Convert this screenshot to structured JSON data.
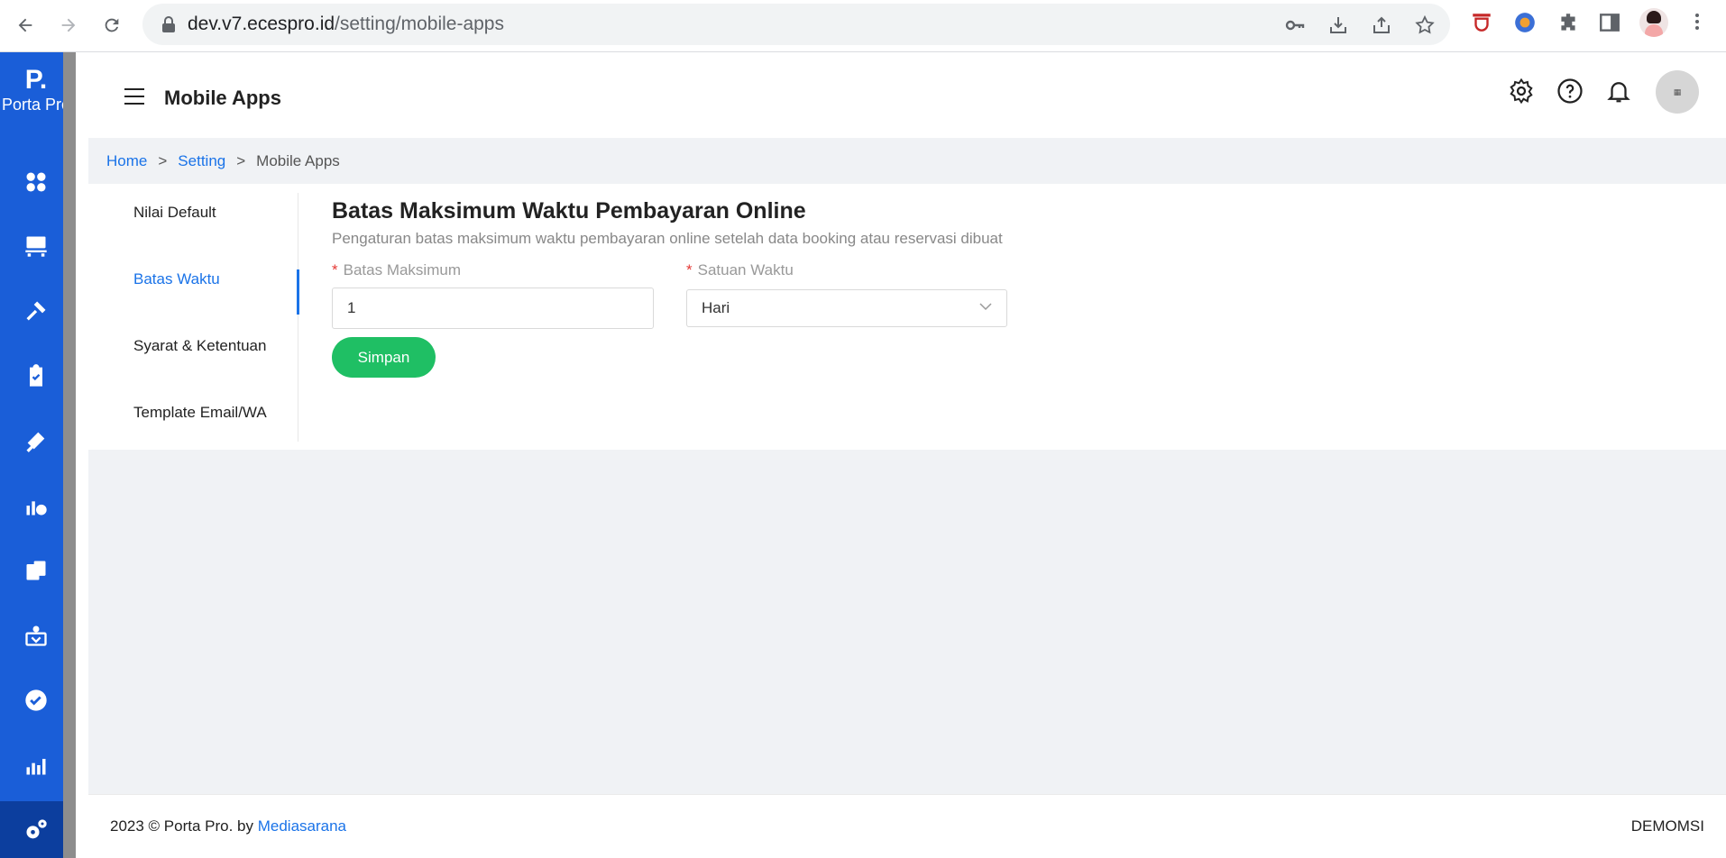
{
  "browser": {
    "url_host": "dev.v7.ecespro.id",
    "url_path": "/setting/mobile-apps"
  },
  "sidebar": {
    "logo_mark": "P.",
    "logo_text": "Porta Pro",
    "items": [
      {
        "icon": "dashboard-icon"
      },
      {
        "icon": "front-desk-icon"
      },
      {
        "icon": "tools-icon"
      },
      {
        "icon": "clipboard-icon"
      },
      {
        "icon": "marketing-icon"
      },
      {
        "icon": "finance-icon"
      },
      {
        "icon": "billing-icon"
      },
      {
        "icon": "network-icon"
      },
      {
        "icon": "verified-icon"
      },
      {
        "icon": "report-icon"
      },
      {
        "icon": "settings-icon"
      }
    ]
  },
  "header": {
    "title": "Mobile Apps",
    "avatar_text": "▦"
  },
  "breadcrumb": {
    "home": "Home",
    "sep": ">",
    "setting": "Setting",
    "current": "Mobile Apps"
  },
  "menu": {
    "items": [
      "Nilai Default",
      "Batas Waktu",
      "Syarat & Ketentuan",
      "Template Email/WA"
    ],
    "active": "Batas Waktu"
  },
  "form": {
    "title": "Batas Maksimum Waktu Pembayaran Online",
    "description": "Pengaturan batas maksimum waktu pembayaran online setelah data booking atau reservasi dibuat",
    "required_mark": "*",
    "max_label": "Batas Maksimum",
    "max_value": "1",
    "unit_label": "Satuan Waktu",
    "unit_value": "Hari",
    "save_label": "Simpan"
  },
  "footer": {
    "copyright": "2023 © Porta Pro. by ",
    "company_link": "Mediasarana",
    "tenant": "DEMOMSI"
  },
  "colors": {
    "sidebar": "#1a5ed8",
    "accent": "#1a73e8",
    "save_button": "#1fbf64"
  }
}
